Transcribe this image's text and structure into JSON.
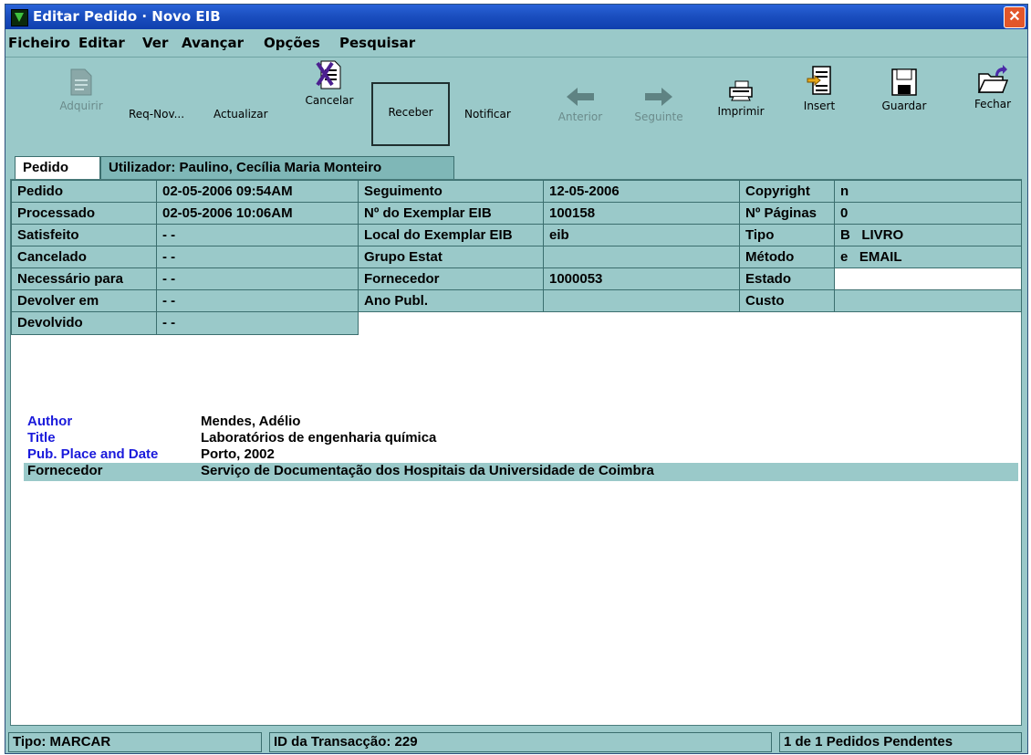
{
  "window": {
    "title": "Editar Pedido · Novo EIB",
    "close_symbol": "✕"
  },
  "menu": [
    "Ficheiro",
    "Editar",
    "Ver",
    "Avançar",
    "Opções",
    "Pesquisar"
  ],
  "toolbar": {
    "adquirir": "Adquirir",
    "req_nov": "Req-Nov...",
    "actualizar": "Actualizar",
    "cancelar": "Cancelar",
    "receber": "Receber",
    "notificar": "Notificar",
    "anterior": "Anterior",
    "seguinte": "Seguinte",
    "imprimir": "Imprimir",
    "insert": "Insert",
    "guardar": "Guardar",
    "fechar": "Fechar"
  },
  "tabs": {
    "pedido": "Pedido",
    "utilizador": "Utilizador: Paulino, Cecília Maria Monteiro"
  },
  "grid": {
    "col1": [
      {
        "label": "Pedido",
        "value": "02-05-2006 09:54AM"
      },
      {
        "label": "Processado",
        "value": "02-05-2006 10:06AM"
      },
      {
        "label": "Satisfeito",
        "value": "- -"
      },
      {
        "label": "Cancelado",
        "value": "- -"
      },
      {
        "label": "Necessário para",
        "value": "- -"
      },
      {
        "label": "Devolver em",
        "value": "- -"
      },
      {
        "label": "Devolvido",
        "value": "- -"
      }
    ],
    "col2": [
      {
        "label": "Seguimento",
        "value": "12-05-2006"
      },
      {
        "label": "Nº do Exemplar EIB",
        "value": "100158"
      },
      {
        "label": "Local do Exemplar EIB",
        "value": "eib"
      },
      {
        "label": "Grupo Estat",
        "value": ""
      },
      {
        "label": "Fornecedor",
        "value": "1000053"
      },
      {
        "label": "Ano Publ.",
        "value": ""
      }
    ],
    "col3": [
      {
        "label": "Copyright",
        "value": "n"
      },
      {
        "label": "Nº Páginas",
        "value": "0"
      },
      {
        "label": "Tipo",
        "value": "B   LIVRO"
      },
      {
        "label": "Método",
        "value": "e   EMAIL"
      },
      {
        "label": "Estado",
        "value": ""
      },
      {
        "label": "Custo",
        "value": ""
      }
    ]
  },
  "info": [
    {
      "key": "Author",
      "value": "Mendes, Adélio"
    },
    {
      "key": "Title",
      "value": "Laboratórios de engenharia química"
    },
    {
      "key": "Pub. Place and Date",
      "value": "Porto, 2002"
    },
    {
      "key": "Fornecedor",
      "value": "Serviço de Documentação dos Hospitais da Universidade de Coimbra"
    }
  ],
  "status": {
    "tipo": "Tipo:  MARCAR",
    "transaccao": "ID da Transacção: 229",
    "pendentes": "1 de 1 Pedidos Pendentes"
  },
  "colors": {
    "accent": "#9ac9c9",
    "title_bar": "#1b4fc0",
    "label_blue": "#1a1adb"
  }
}
